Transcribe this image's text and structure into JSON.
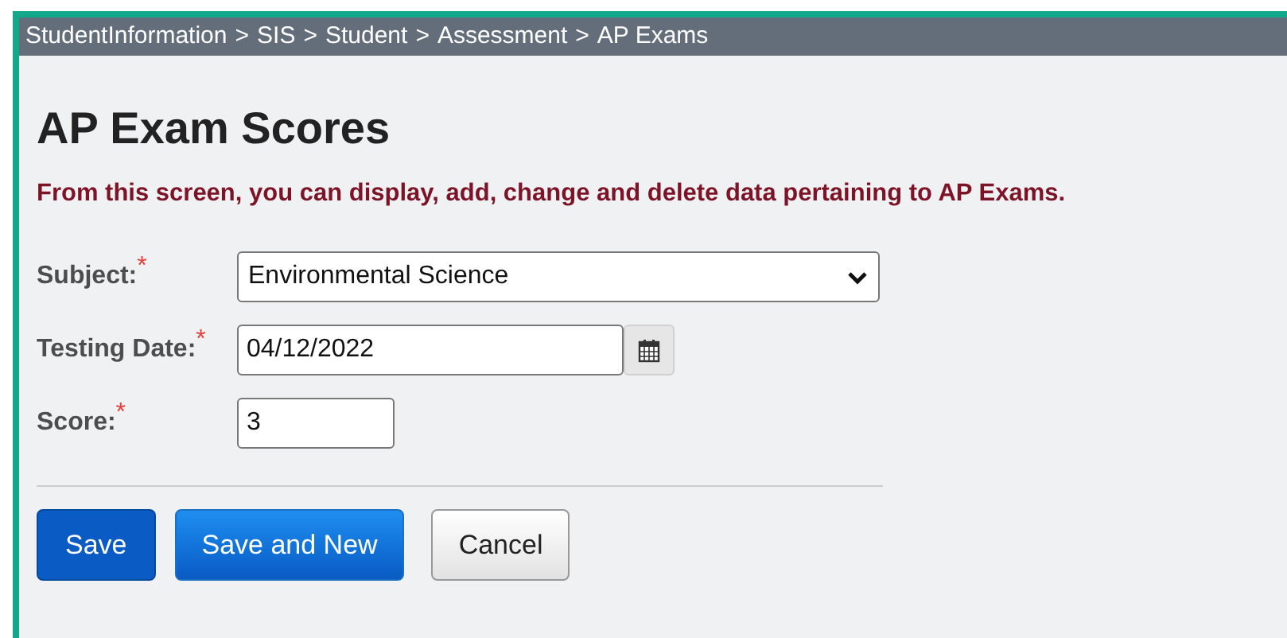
{
  "breadcrumb": [
    "StudentInformation",
    "SIS",
    "Student",
    "Assessment",
    "AP Exams"
  ],
  "breadcrumb_separator": ">",
  "title": "AP Exam Scores",
  "description": "From this screen, you can display, add, change and delete data pertaining to AP Exams.",
  "fields": [
    {
      "kind": "select",
      "label": "Subject:",
      "required": true,
      "value": "Environmental Science"
    },
    {
      "kind": "date",
      "label": "Testing Date:",
      "required": true,
      "value": "04/12/2022"
    },
    {
      "kind": "text",
      "label": "Score:",
      "required": true,
      "value": "3"
    }
  ],
  "required_mark": "*",
  "buttons": [
    {
      "kind": "primary",
      "label": "Save"
    },
    {
      "kind": "secondary",
      "label": "Save and New"
    },
    {
      "kind": "plain",
      "label": "Cancel"
    }
  ]
}
